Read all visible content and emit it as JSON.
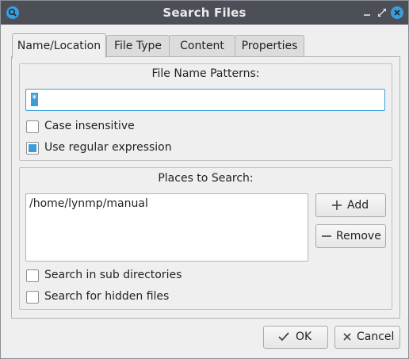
{
  "window": {
    "title": "Search Files",
    "app_icon": "search-icon",
    "controls": [
      "minimize-icon",
      "maximize-icon",
      "close-icon"
    ],
    "accent_color": "#3c9ddb",
    "titlebar_color": "#4c4f56"
  },
  "tabs": [
    {
      "label": "Name/Location",
      "active": true
    },
    {
      "label": "File Type",
      "active": false
    },
    {
      "label": "Content",
      "active": false
    },
    {
      "label": "Properties",
      "active": false
    }
  ],
  "name_patterns": {
    "title": "File Name Patterns:",
    "value": "*",
    "case_insensitive": {
      "label": "Case insensitive",
      "checked": false
    },
    "use_regex": {
      "label": "Use regular expression",
      "checked": true
    }
  },
  "places": {
    "title": "Places to Search:",
    "items": [
      "/home/lynmp/manual"
    ],
    "add_label": "Add",
    "remove_label": "Remove",
    "sub_dirs": {
      "label": "Search in sub directories",
      "checked": false
    },
    "hidden_files": {
      "label": "Search for hidden files",
      "checked": false
    }
  },
  "footer": {
    "ok_label": "OK",
    "cancel_label": "Cancel"
  }
}
